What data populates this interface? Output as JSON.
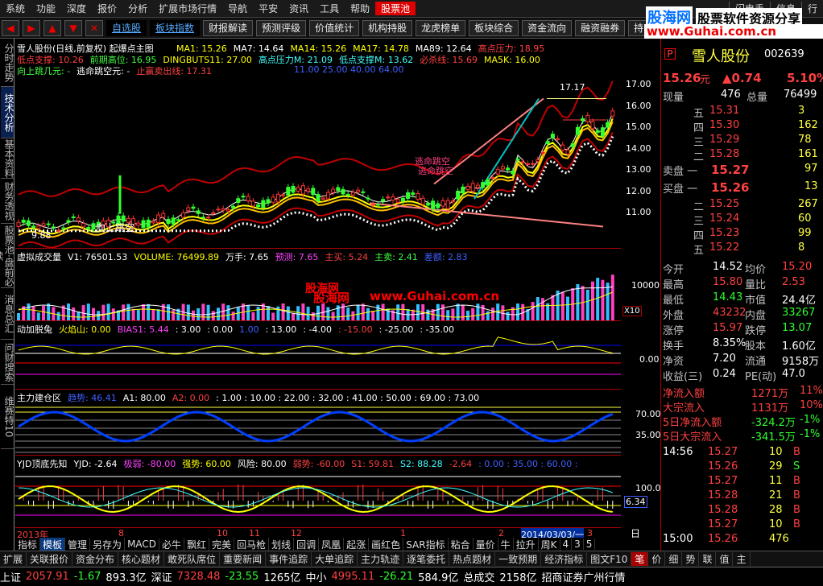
{
  "menu": {
    "items": [
      "系统",
      "功能",
      "深度",
      "报价",
      "分析",
      "扩展市场行情",
      "导航",
      "平安",
      "资讯",
      "工具",
      "帮助",
      "股票池"
    ],
    "right": [
      "闪电手",
      "信息",
      "行"
    ]
  },
  "toolbar": {
    "buttons": [
      "自选股",
      "板块指数",
      "财报解读",
      "预测评级",
      "价值统计",
      "机构持股",
      "龙虎榜单",
      "板块综合",
      "资金流向",
      "融资融券",
      "持"
    ]
  },
  "watermark": {
    "logo": "股海网",
    "url": "www.Guhai.com.cn",
    "slogan": "股票软件资源分享"
  },
  "lefttabs": [
    "分时走势",
    "技术分析",
    "基本资料",
    "财务透视",
    "股票池·盘前必读",
    "消息总汇",
    "问财搜索",
    "维赛特10"
  ],
  "main": {
    "title": "雪人股份(日线,前复权) 起爆点主图",
    "ma": [
      {
        "t": "MA1: 15.26",
        "c": "#ffff00"
      },
      {
        "t": "MA7: 14.64",
        "c": "#ffffff"
      },
      {
        "t": "MA14: 15.26",
        "c": "#ffff00"
      },
      {
        "t": "MA17: 14.78",
        "c": "#ffff00"
      },
      {
        "t": "MA89: 12.64",
        "c": "#ffffff"
      },
      {
        "t": "高点压力: 18.95",
        "c": "#ff4040"
      }
    ],
    "line2": [
      {
        "t": "低点支撑: 10.26",
        "c": "#ff4040"
      },
      {
        "t": "前期高位: 16.95",
        "c": "#40ff40"
      },
      {
        "t": "DINGBUTS11: 27.00",
        "c": "#ffff00"
      },
      {
        "t": "高点压力M: 21.09",
        "c": "#40ffff"
      },
      {
        "t": "低点支撑M: 13.62",
        "c": "#40ffff"
      },
      {
        "t": "必杀线: 15.69",
        "c": "#ff4040"
      },
      {
        "t": "MA5K: 16.00",
        "c": "#ffff00"
      }
    ],
    "line3": [
      {
        "t": "向上跳几元: -",
        "c": "#40ff40"
      },
      {
        "t": "逃命跳空元: -",
        "c": "#ffffff"
      },
      {
        "t": "止赢卖出线: 17.31",
        "c": "#ff4040"
      }
    ],
    "line4": "11.00   25.00   40.00   64.00",
    "axis": [
      "17.00",
      "16.00",
      "15.00",
      "14.00",
      "13.00",
      "12.00",
      "11.00"
    ],
    "annot_low": "9.88",
    "annot_gap": "向上跳空",
    "annot_high": "17.17",
    "annot_mid1": "逃命跳空",
    "annot_mid2": "逃命跳空"
  },
  "vol": {
    "title": "虚拟成交量",
    "items": [
      {
        "t": "V1: 76501.53",
        "c": "#ffffff"
      },
      {
        "t": "VOLUME: 76499.89",
        "c": "#ffff00"
      },
      {
        "t": "万手: 7.65",
        "c": "#ffffff"
      },
      {
        "t": "预测: 7.65",
        "c": "#ff40ff"
      },
      {
        "t": "主买: 5.24",
        "c": "#ff4040"
      },
      {
        "t": "主卖: 2.41",
        "c": "#40ff40"
      },
      {
        "t": "差额: 2.83",
        "c": "#4060ff"
      }
    ],
    "axis": "10000",
    "x10": "X10"
  },
  "bias": {
    "title": "动加脱兔",
    "items": [
      {
        "t": "火焰山: 0.00",
        "c": "#ffff00"
      },
      {
        "t": "BIAS1: 5.44",
        "c": "#ff40ff"
      },
      {
        "t": ": 3.00",
        "c": "#ffffff"
      },
      {
        "t": ": 0.00",
        "c": "#ffffff"
      },
      {
        "t": "1.00",
        "c": "#4060ff"
      },
      {
        "t": ": 13.00",
        "c": "#ffffff"
      },
      {
        "t": ": -4.00",
        "c": "#ffffff"
      },
      {
        "t": ": -15.00",
        "c": "#ff4040"
      },
      {
        "t": ": -25.00",
        "c": "#ffffff"
      },
      {
        "t": ": -35.00",
        "c": "#ffffff"
      }
    ],
    "axis": "0.00"
  },
  "zl": {
    "title": "主力建仓区",
    "items": [
      {
        "t": "趋势: 46.41",
        "c": "#4060ff"
      },
      {
        "t": "A1: 80.00",
        "c": "#ffffff"
      },
      {
        "t": "A2: 0.00",
        "c": "#ff4040"
      },
      {
        "t": ": 1.00 : 10.00 : 22.00 : 32.00 : 41.00 : 50.00 : 69.00 : 73.00",
        "c": "#ffffff"
      }
    ],
    "axis": [
      "70.00",
      "35.00"
    ]
  },
  "yjd": {
    "title": "YJD顶底先知",
    "items": [
      {
        "t": "YJD: -2.64",
        "c": "#ffffff"
      },
      {
        "t": "极弱: -80.00",
        "c": "#ff40ff"
      },
      {
        "t": "强势: 60.00",
        "c": "#ffff00"
      },
      {
        "t": "风险: 80.00",
        "c": "#ffffff"
      },
      {
        "t": "弱势: -60.00",
        "c": "#ff4040"
      },
      {
        "t": "S1: 59.81",
        "c": "#ff4040"
      },
      {
        "t": "S2: 88.28",
        "c": "#40ffff"
      },
      {
        "t": "-2.64",
        "c": "#ff4040"
      },
      {
        "t": ": 0.00 : 35.00 : 60.00 :",
        "c": "#4060ff"
      }
    ],
    "axis": [
      "100.0",
      "6.34"
    ]
  },
  "xaxis": [
    "2013年",
    "8",
    "10",
    "11",
    "12",
    "1",
    "2",
    "2014/03/03/一",
    "3"
  ],
  "xaxis_right": "日线",
  "subtabs": [
    "指标",
    "模板",
    "管理",
    "另存为",
    "MACD",
    "必牛",
    "飘红",
    "完美",
    "回马枪",
    "划线",
    "回调",
    "凤凰",
    "起涨",
    "画红色",
    "SAR指标",
    "粘合",
    "量价",
    "牛",
    "拉升",
    "周K",
    "4",
    "3",
    "5"
  ],
  "bottom": [
    "扩展",
    "关联报价",
    "资金分布",
    "核心题材",
    "敢死队席位",
    "重要新闻",
    "事件追踪",
    "大单追踪",
    "主力轨迹",
    "逐笔委托",
    "热点题材",
    "一致预期",
    "经济指标",
    "图文F10",
    "笔",
    "价",
    "细",
    "势",
    "联",
    "值",
    "主"
  ],
  "quote": {
    "code": "002639",
    "name": "雪人股份",
    "price": "15.26",
    "unit": "元",
    "change": "▲0.74",
    "pct": "5.10%",
    "xianliang_l": "现量",
    "xianliang": "476",
    "zongliang_l": "总量",
    "zongliang": "76499",
    "sells": [
      {
        "l": "五",
        "p": "15.31",
        "v": "3"
      },
      {
        "l": "四",
        "p": "15.30",
        "v": "162"
      },
      {
        "l": "三",
        "p": "15.29",
        "v": "78"
      },
      {
        "l": "二",
        "p": "15.28",
        "v": "161"
      }
    ],
    "sell1": {
      "l": "卖盘 一",
      "p": "15.27",
      "v": "97"
    },
    "buy1": {
      "l": "买盘 一",
      "p": "15.26",
      "v": "13"
    },
    "buys": [
      {
        "l": "二",
        "p": "15.25",
        "v": "267"
      },
      {
        "l": "三",
        "p": "15.24",
        "v": "60"
      },
      {
        "l": "四",
        "p": "15.23",
        "v": "99"
      },
      {
        "l": "五",
        "p": "15.22",
        "v": "8"
      }
    ],
    "stats": [
      {
        "a": "今开",
        "av": "14.52",
        "ac": "white",
        "b": "均价",
        "bv": "15.20",
        "bc": "red"
      },
      {
        "a": "最高",
        "av": "15.80",
        "ac": "red",
        "b": "量比",
        "bv": "2.53",
        "bc": "red"
      },
      {
        "a": "最低",
        "av": "14.43",
        "ac": "green",
        "b": "市值",
        "bv": "24.4亿",
        "bc": "white"
      },
      {
        "a": "外盘",
        "av": "43232",
        "ac": "red",
        "b": "内盘",
        "bv": "33267",
        "bc": "green"
      },
      {
        "a": "涨停",
        "av": "15.97",
        "ac": "red",
        "b": "跌停",
        "bv": "13.07",
        "bc": "green"
      },
      {
        "a": "换手",
        "av": "8.35%",
        "ac": "white",
        "b": "股本",
        "bv": "1.60亿",
        "bc": "white"
      },
      {
        "a": "净资",
        "av": "7.20",
        "ac": "white",
        "b": "流通",
        "bv": "9158万",
        "bc": "white"
      },
      {
        "a": "收益(三)",
        "av": "0.24",
        "ac": "white",
        "b": "PE(动)",
        "bv": "47.0",
        "bc": "white"
      }
    ],
    "flows": [
      {
        "l": "净流入额",
        "v": "1271万",
        "p": "11%",
        "c": "red"
      },
      {
        "l": "大宗流入",
        "v": "1131万",
        "p": "10%",
        "c": "red"
      },
      {
        "l": "5日净流入额",
        "v": "-324.2万",
        "p": "-1%",
        "c": "green"
      },
      {
        "l": "5日大宗流入",
        "v": "-341.5万",
        "p": "-1%",
        "c": "green"
      }
    ],
    "ticks": [
      {
        "t": "14:56",
        "p": "15.27",
        "v": "10",
        "d": "B",
        "dc": "red"
      },
      {
        "t": "",
        "p": "15.26",
        "v": "29",
        "d": "S",
        "dc": "green"
      },
      {
        "t": "",
        "p": "15.27",
        "v": "11",
        "d": "B",
        "dc": "red"
      },
      {
        "t": "",
        "p": "15.28",
        "v": "21",
        "d": "B",
        "dc": "red"
      },
      {
        "t": "",
        "p": "15.28",
        "v": "28",
        "d": "B",
        "dc": "red"
      },
      {
        "t": "",
        "p": "15.27",
        "v": "10",
        "d": "B",
        "dc": "red"
      },
      {
        "t": "15:00",
        "p": "15.26",
        "v": "476",
        "d": "",
        "dc": "red"
      }
    ]
  },
  "status": {
    "items": [
      {
        "t": "上证",
        "c": "white"
      },
      {
        "t": "2057.91",
        "c": "red"
      },
      {
        "t": "-1.67",
        "c": "green"
      },
      {
        "t": "893.3亿",
        "c": "white"
      },
      {
        "t": "深证",
        "c": "white"
      },
      {
        "t": "7328.48",
        "c": "red"
      },
      {
        "t": "-23.55",
        "c": "green"
      },
      {
        "t": "1265亿",
        "c": "white"
      },
      {
        "t": "中小",
        "c": "white"
      },
      {
        "t": "4995.11",
        "c": "red"
      },
      {
        "t": "-26.21",
        "c": "green"
      },
      {
        "t": "584.9亿",
        "c": "white"
      },
      {
        "t": "总成交",
        "c": "white"
      },
      {
        "t": "2158亿",
        "c": "white"
      },
      {
        "t": "招商证券广州行情",
        "c": "white"
      }
    ]
  }
}
